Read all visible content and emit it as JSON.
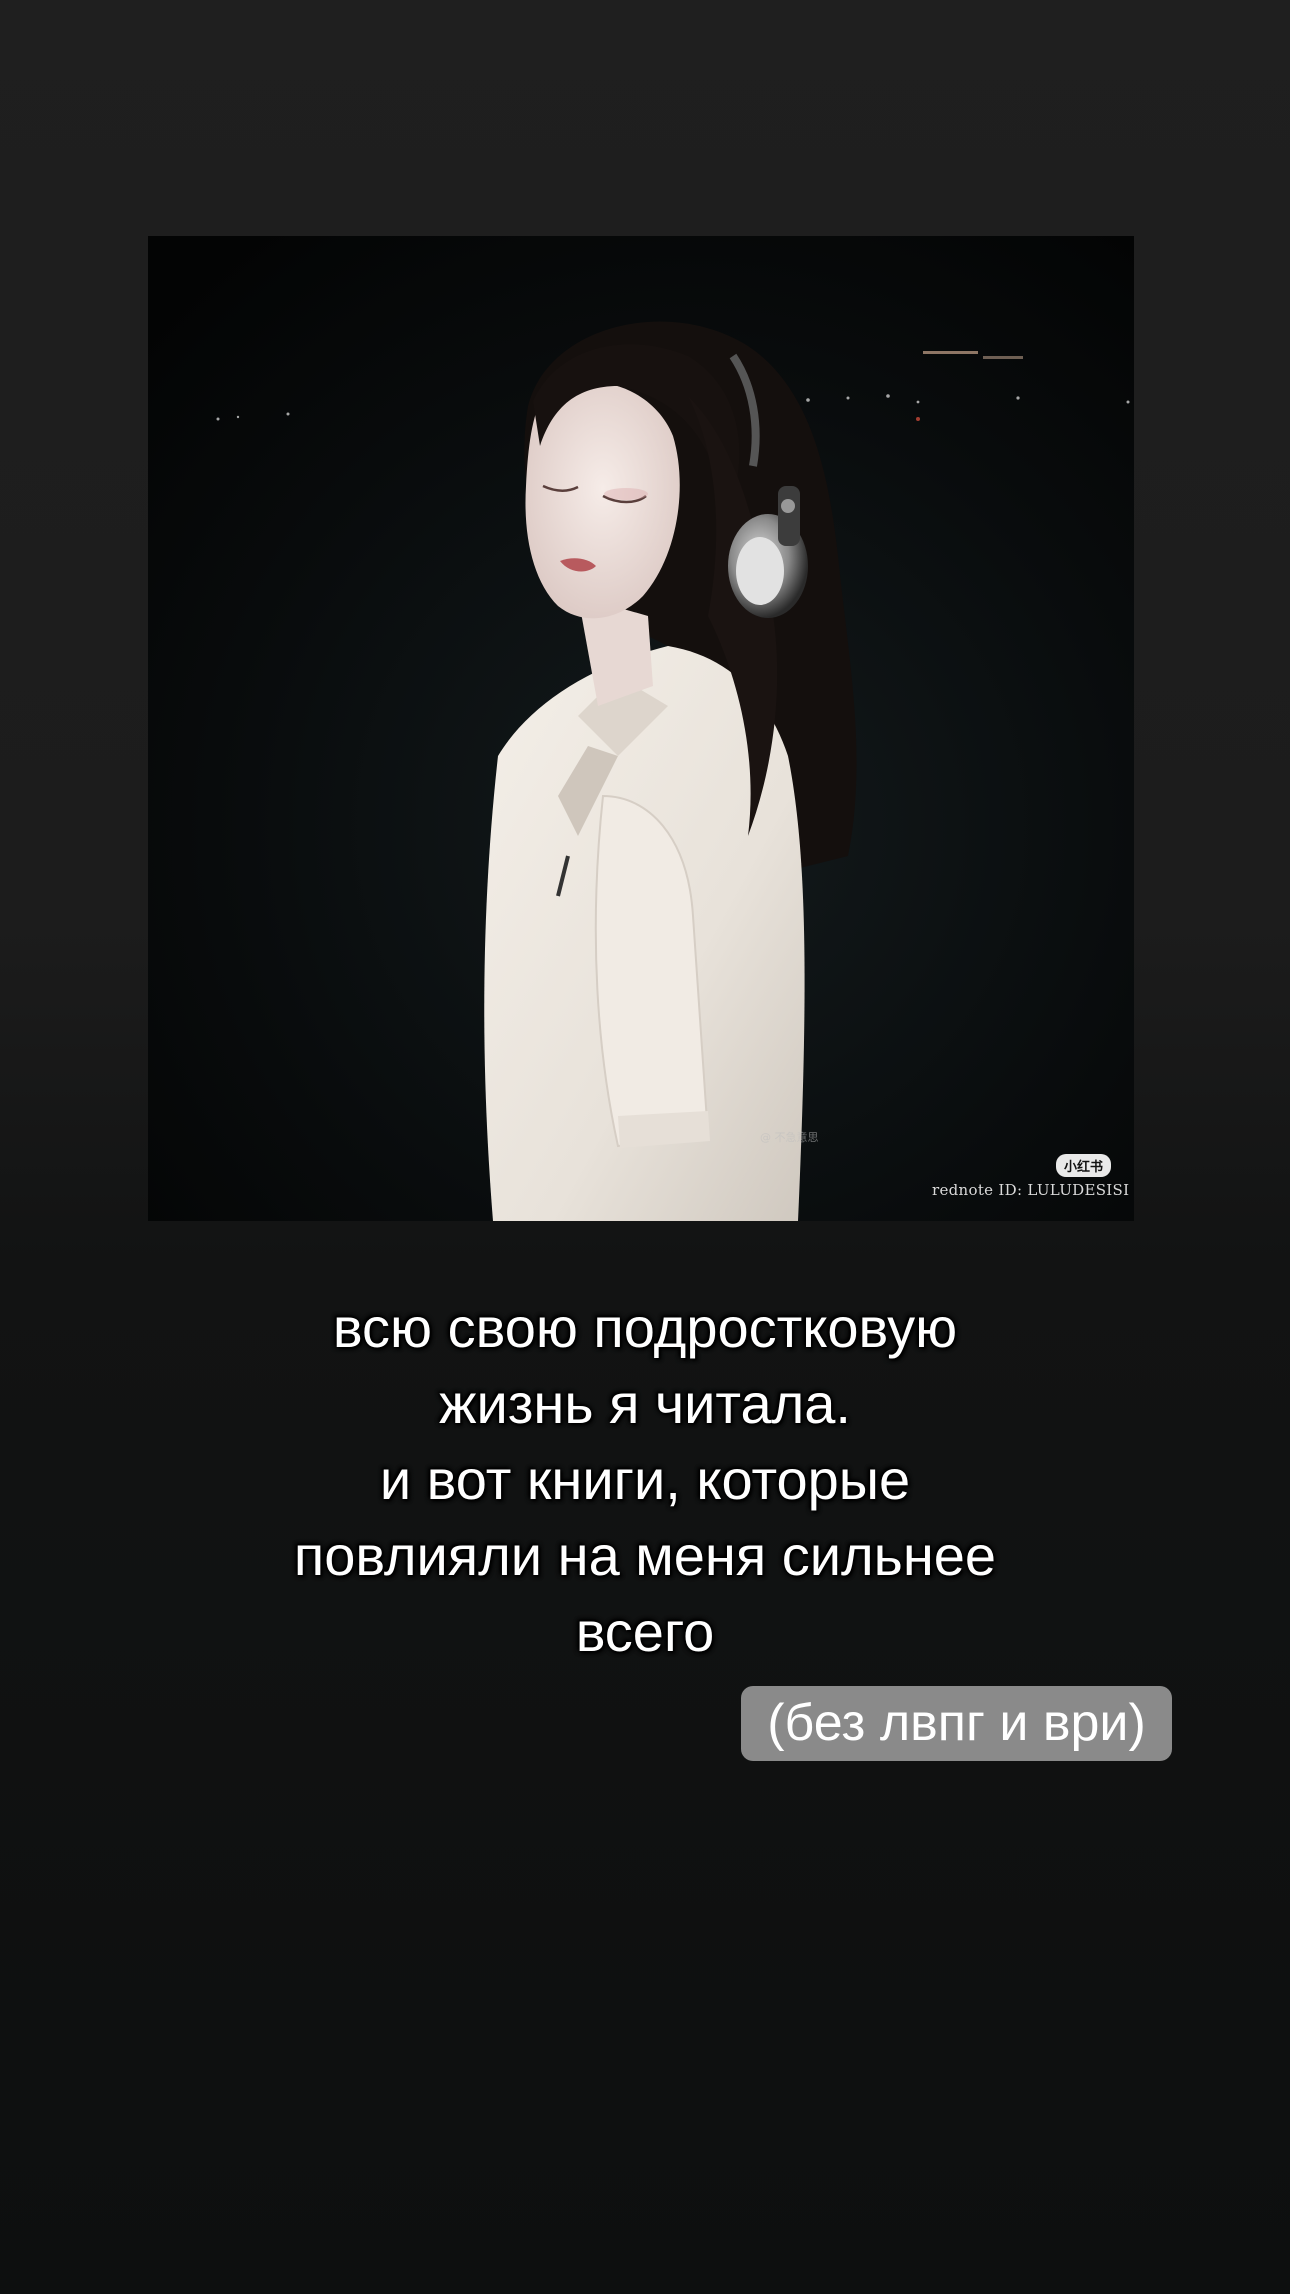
{
  "story": {
    "photo": {
      "watermark_badge": "小红书",
      "watermark_id": "rednote ID: LULUDESISI",
      "watermark_small": "@ 不急意思"
    },
    "caption_lines": [
      "всю свою подростковую",
      "жизнь я читала.",
      "и вот книги, которые",
      "повлияли на меня сильнее",
      "всего"
    ],
    "note_pill": "(без лвпг и ври)"
  },
  "colors": {
    "background_top": "#1f1f1f",
    "background_bottom": "#0d0f0f",
    "caption_text": "#ffffff",
    "pill_background": "#8a8a8a"
  }
}
